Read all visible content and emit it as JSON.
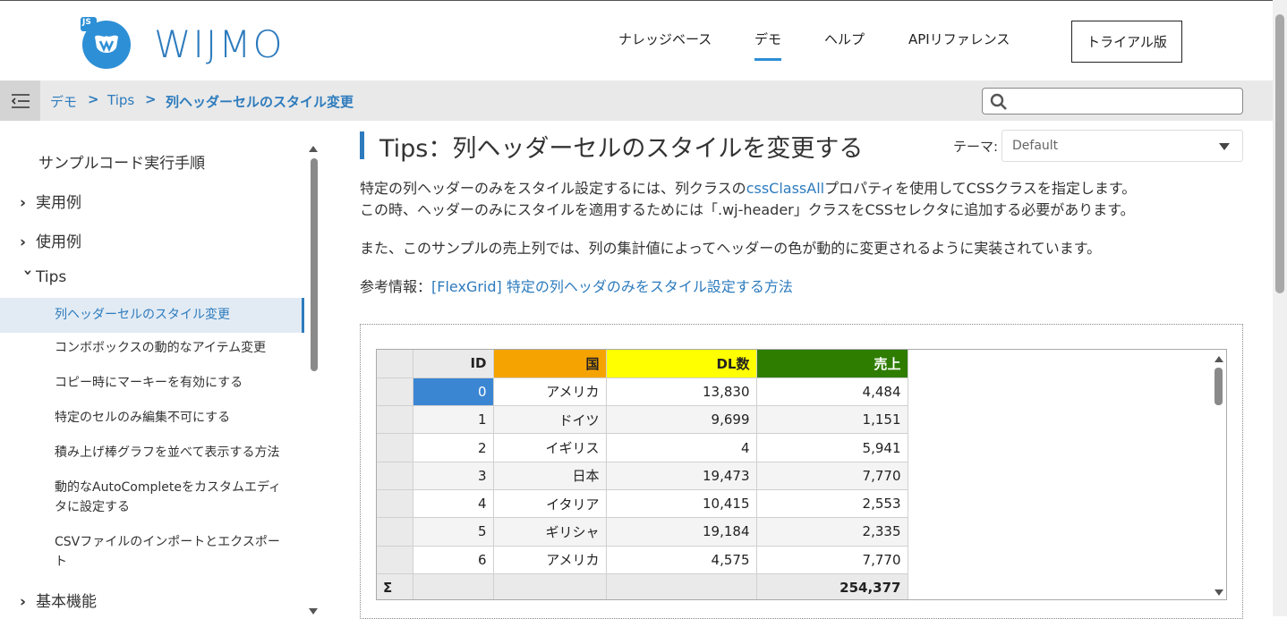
{
  "brand": {
    "name": "WIJMO",
    "badge": "JS",
    "color": "#2d7bbd"
  },
  "nav": {
    "items": [
      "ナレッジベース",
      "デモ",
      "ヘルプ",
      "APIリファレンス"
    ],
    "active_index": 1,
    "trial_label": "トライアル版"
  },
  "breadcrumb": {
    "items": [
      "デモ",
      "Tips",
      "列ヘッダーセルのスタイル変更"
    ],
    "separator": ">"
  },
  "search": {
    "placeholder": ""
  },
  "sidebar": {
    "top_item": "サンプルコード実行手順",
    "sections": [
      {
        "label": "実用例",
        "expanded": false
      },
      {
        "label": "使用例",
        "expanded": false
      },
      {
        "label": "Tips",
        "expanded": true
      },
      {
        "label": "基本機能",
        "expanded": false
      }
    ],
    "tips_items": [
      "列ヘッダーセルのスタイル変更",
      "コンボボックスの動的なアイテム変更",
      "コピー時にマーキーを有効にする",
      "特定のセルのみ編集不可にする",
      "積み上げ棒グラフを並べて表示する方法",
      "動的なAutoCompleteをカスタムエディ",
      "タに設定する",
      "CSVファイルのインポートとエクスポー",
      "ト"
    ],
    "active_index": 0
  },
  "main": {
    "title": "Tips：列ヘッダーセルのスタイルを変更する",
    "theme_label": "テーマ:",
    "theme_value": "Default",
    "para1_a": "特定の列ヘッダーのみをスタイル設定するには、列クラスの",
    "para1_link": "cssClassAll",
    "para1_b": "プロパティを使用してCSSクラスを指定します。",
    "para1_line2": "この時、ヘッダーのみにスタイルを適用するためには「.wj-header」クラスをCSSセレクタに追加する必要があります。",
    "para2": "また、このサンプルの売上列では、列の集計値によってヘッダーの色が動的に変更されるように実装されています。",
    "ref_label": "参考情報：",
    "ref_link": "[FlexGrid] 特定の列ヘッダのみをスタイル設定する方法"
  },
  "grid": {
    "headers": [
      "ID",
      "国",
      "DL数",
      "売上"
    ],
    "header_colors": [
      "#eaeaea",
      "#f5a300",
      "#ffff00",
      "#2e7d00"
    ],
    "rows": [
      [
        "0",
        "アメリカ",
        "13,830",
        "4,484"
      ],
      [
        "1",
        "ドイツ",
        "9,699",
        "1,151"
      ],
      [
        "2",
        "イギリス",
        "4",
        "5,941"
      ],
      [
        "3",
        "日本",
        "19,473",
        "7,770"
      ],
      [
        "4",
        "イタリア",
        "10,415",
        "2,553"
      ],
      [
        "5",
        "ギリシャ",
        "19,184",
        "2,335"
      ],
      [
        "6",
        "アメリカ",
        "4,575",
        "7,770"
      ]
    ],
    "footer": {
      "row_header": "Σ",
      "sales_total": "254,377"
    }
  }
}
